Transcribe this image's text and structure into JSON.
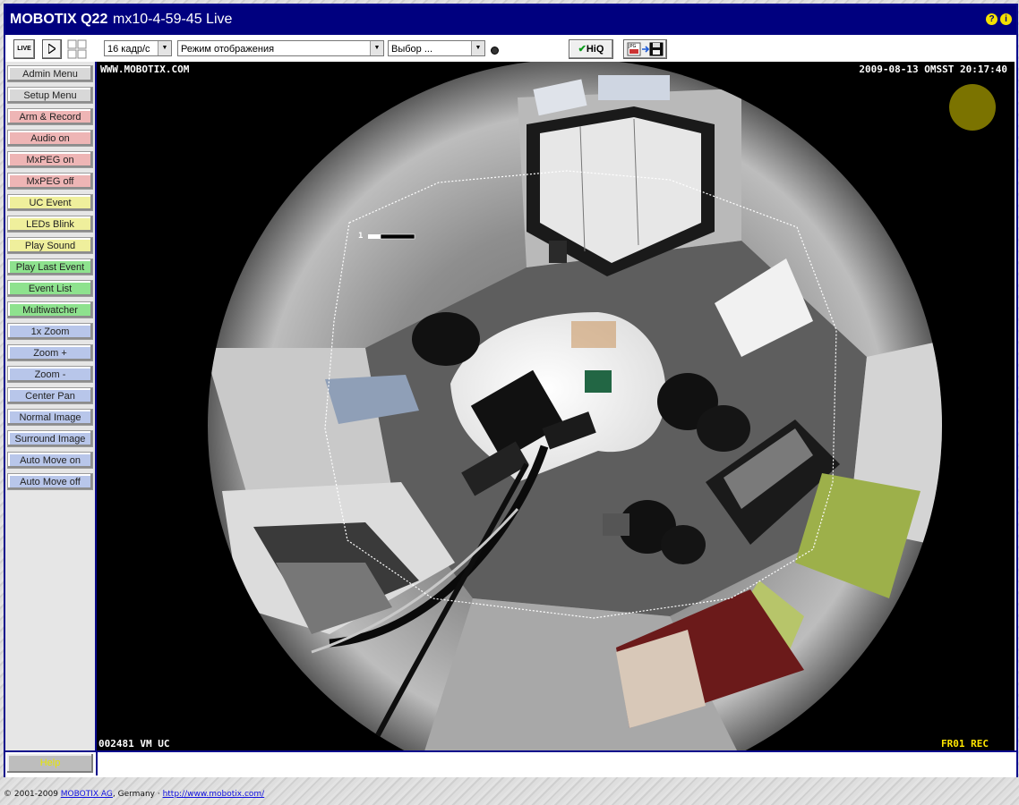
{
  "window": {
    "brand": "MOBOTIX Q22",
    "title": "mx10-4-59-45 Live",
    "help_icons": [
      "?",
      "i"
    ]
  },
  "toolbar": {
    "live_label": "LIVE",
    "framerate": "16 кадр/с",
    "display_mode": "Режим отображения",
    "choice": "Выбор ...",
    "hiq_label": "HiQ",
    "jpg_label": "JPG"
  },
  "sidebar": {
    "items": [
      {
        "label": "Admin Menu",
        "color": "gray"
      },
      {
        "label": "Setup Menu",
        "color": "gray"
      },
      {
        "label": "Arm & Record",
        "color": "pink"
      },
      {
        "label": "Audio on",
        "color": "pink"
      },
      {
        "label": "MxPEG on",
        "color": "pink"
      },
      {
        "label": "MxPEG off",
        "color": "pink"
      },
      {
        "label": "UC Event",
        "color": "yellow"
      },
      {
        "label": "LEDs Blink",
        "color": "yellow"
      },
      {
        "label": "Play Sound",
        "color": "yellow"
      },
      {
        "label": "Play Last Event",
        "color": "green"
      },
      {
        "label": "Event List",
        "color": "green"
      },
      {
        "label": "Multiwatcher",
        "color": "green"
      },
      {
        "label": "1x Zoom",
        "color": "blue"
      },
      {
        "label": "Zoom +",
        "color": "blue"
      },
      {
        "label": "Zoom -",
        "color": "blue"
      },
      {
        "label": "Center Pan",
        "color": "blue"
      },
      {
        "label": "Normal Image",
        "color": "blue"
      },
      {
        "label": "Surround Image",
        "color": "blue"
      },
      {
        "label": "Auto Move on",
        "color": "blue"
      },
      {
        "label": "Auto Move off",
        "color": "blue"
      }
    ],
    "help_label": "Help"
  },
  "overlay": {
    "top_left": "WWW.MOBOTIX.COM",
    "top_right": "2009-08-13 OMSST 20:17:40",
    "bottom_left": "002481 VM UC",
    "bottom_right": "FR01 REC",
    "area_label": "1"
  },
  "colors": {
    "frame_blue": "#00007f",
    "status_dot": "#7b7300",
    "overlay_white": "#ffffff",
    "overlay_yellow": "#ffe600"
  },
  "footer": {
    "copyright": "© 2001-2009 ",
    "company_link": "MOBOTIX AG",
    "country": ", Germany · ",
    "url": "http://www.mobotix.com/"
  }
}
